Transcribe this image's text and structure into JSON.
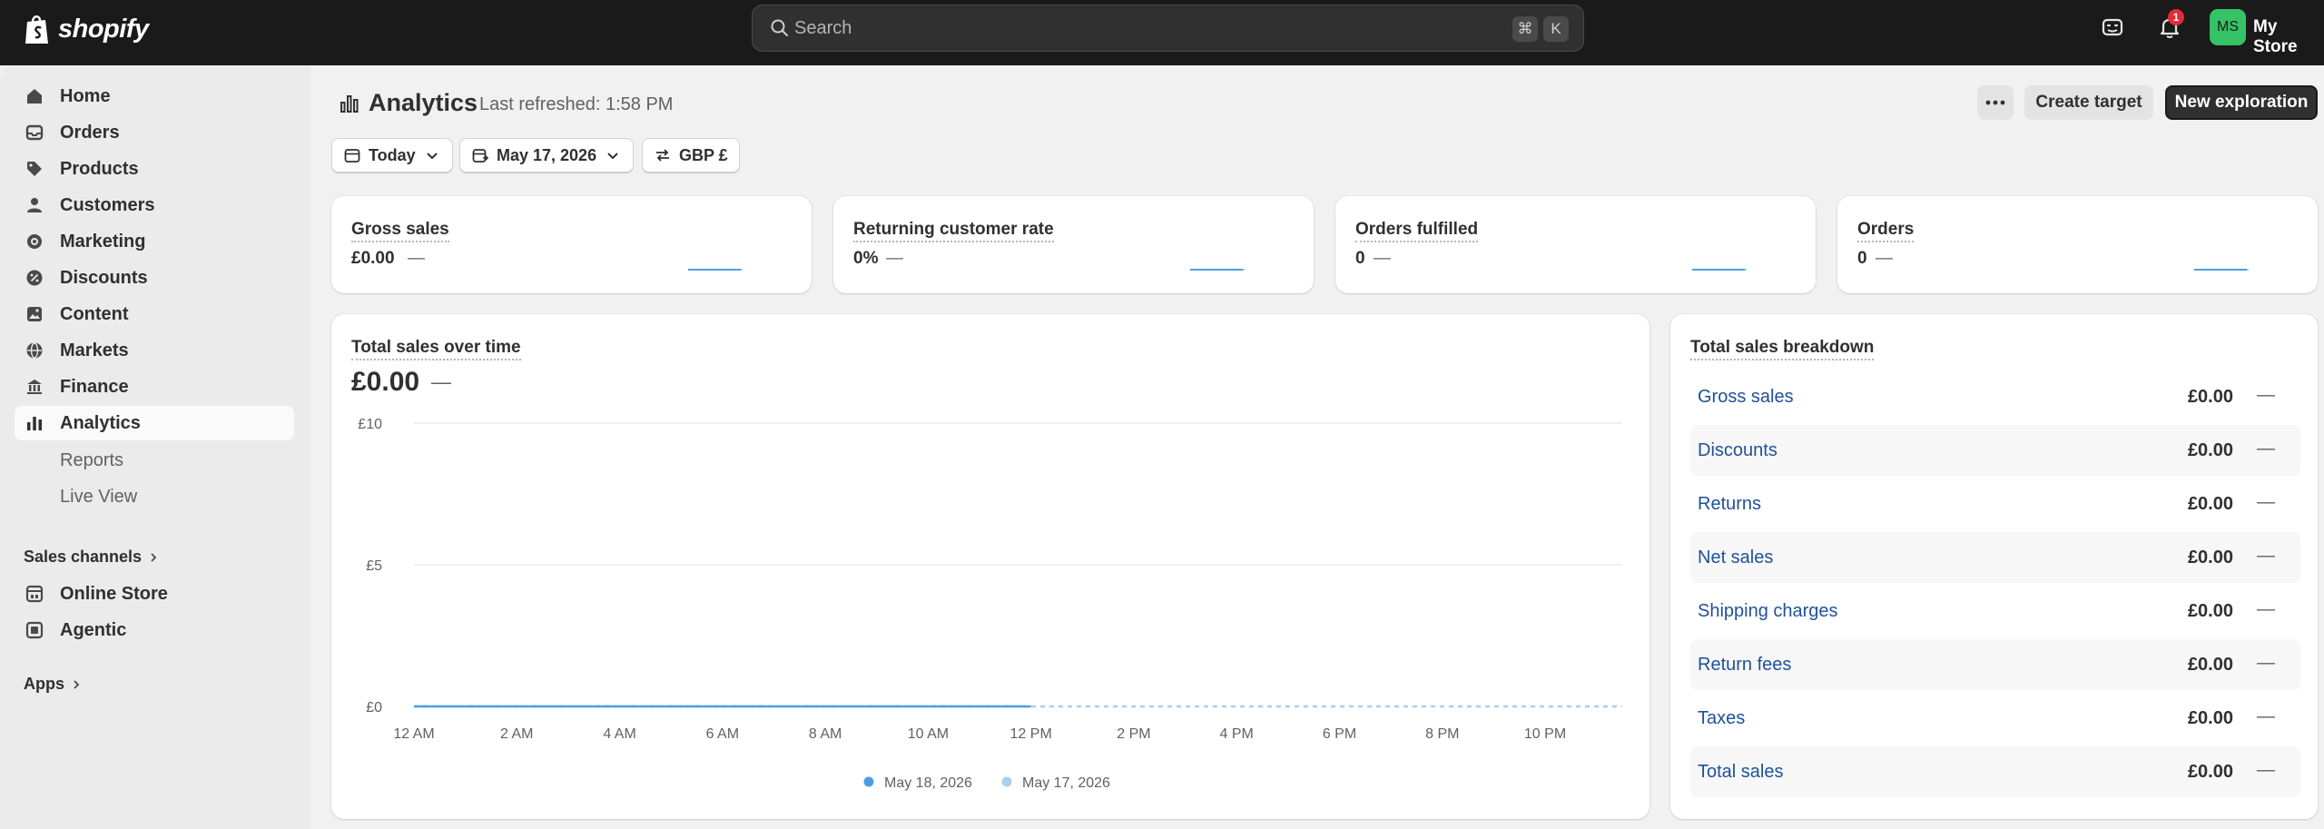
{
  "topbar": {
    "logo_text": "shopify",
    "search_placeholder": "Search",
    "shortcut_key1": "⌘",
    "shortcut_key2": "K",
    "notification_count": "1",
    "avatar_initials": "MS",
    "store_name": "My Store",
    "colors": {
      "background": "#1a1a1a",
      "avatar": "#36c267",
      "badge": "#e22c38"
    }
  },
  "sidebar": {
    "items": [
      {
        "label": "Home",
        "icon": "home-icon"
      },
      {
        "label": "Orders",
        "icon": "inbox-icon"
      },
      {
        "label": "Products",
        "icon": "tag-icon"
      },
      {
        "label": "Customers",
        "icon": "person-icon"
      },
      {
        "label": "Marketing",
        "icon": "target-icon"
      },
      {
        "label": "Discounts",
        "icon": "discount-icon"
      },
      {
        "label": "Content",
        "icon": "image-icon"
      },
      {
        "label": "Markets",
        "icon": "globe-icon"
      },
      {
        "label": "Finance",
        "icon": "bank-icon"
      },
      {
        "label": "Analytics",
        "icon": "chart-icon",
        "active": true
      }
    ],
    "sub_items": [
      "Reports",
      "Live View"
    ],
    "sales_channels_label": "Sales channels",
    "channels": [
      {
        "label": "Online Store",
        "icon": "store-icon"
      },
      {
        "label": "Agentic",
        "icon": "agentic-icon"
      }
    ],
    "apps_label": "Apps"
  },
  "header": {
    "title": "Analytics",
    "last_refreshed": "Last refreshed: 1:58 PM",
    "create_target": "Create target",
    "new_exploration": "New exploration"
  },
  "filters": {
    "date_range": "Today",
    "compare_date": "May 17, 2026",
    "currency": "GBP £"
  },
  "metrics": [
    {
      "label": "Gross sales",
      "value": "£0.00",
      "trend": "—"
    },
    {
      "label": "Returning customer rate",
      "value": "0%",
      "trend": "—"
    },
    {
      "label": "Orders fulfilled",
      "value": "0",
      "trend": "—"
    },
    {
      "label": "Orders",
      "value": "0",
      "trend": "—"
    }
  ],
  "sales_chart": {
    "title": "Total sales over time",
    "total": "£0.00",
    "trend": "—",
    "legend": [
      "May 18, 2026",
      "May 17, 2026"
    ]
  },
  "chart_data": {
    "type": "line",
    "title": "Total sales over time",
    "xlabel": "",
    "ylabel": "",
    "y_tick_labels": [
      "£0",
      "£5",
      "£10"
    ],
    "y_ticks": [
      0,
      5,
      10
    ],
    "ylim": [
      0,
      10
    ],
    "x_tick_labels": [
      "12 AM",
      "2 AM",
      "4 AM",
      "6 AM",
      "8 AM",
      "10 AM",
      "12 PM",
      "2 PM",
      "4 PM",
      "6 PM",
      "8 PM",
      "10 PM"
    ],
    "x_hours": [
      0,
      2,
      4,
      6,
      8,
      10,
      12,
      14,
      16,
      18,
      20,
      22
    ],
    "xlim": [
      0,
      23.5
    ],
    "grid": true,
    "legend_position": "bottom",
    "series": [
      {
        "name": "May 18, 2026",
        "style": "solid",
        "color": "#4b9fe1",
        "x": [
          0,
          12
        ],
        "values": [
          0,
          0
        ]
      },
      {
        "name": "May 17, 2026",
        "style": "dashed",
        "color": "#a9cfee",
        "x": [
          0,
          23.5
        ],
        "values": [
          0,
          0
        ]
      }
    ]
  },
  "breakdown": {
    "title": "Total sales breakdown",
    "rows": [
      {
        "label": "Gross sales",
        "value": "£0.00",
        "trend": "—"
      },
      {
        "label": "Discounts",
        "value": "£0.00",
        "trend": "—"
      },
      {
        "label": "Returns",
        "value": "£0.00",
        "trend": "—"
      },
      {
        "label": "Net sales",
        "value": "£0.00",
        "trend": "—"
      },
      {
        "label": "Shipping charges",
        "value": "£0.00",
        "trend": "—"
      },
      {
        "label": "Return fees",
        "value": "£0.00",
        "trend": "—"
      },
      {
        "label": "Taxes",
        "value": "£0.00",
        "trend": "—"
      },
      {
        "label": "Total sales",
        "value": "£0.00",
        "trend": "—"
      }
    ]
  }
}
